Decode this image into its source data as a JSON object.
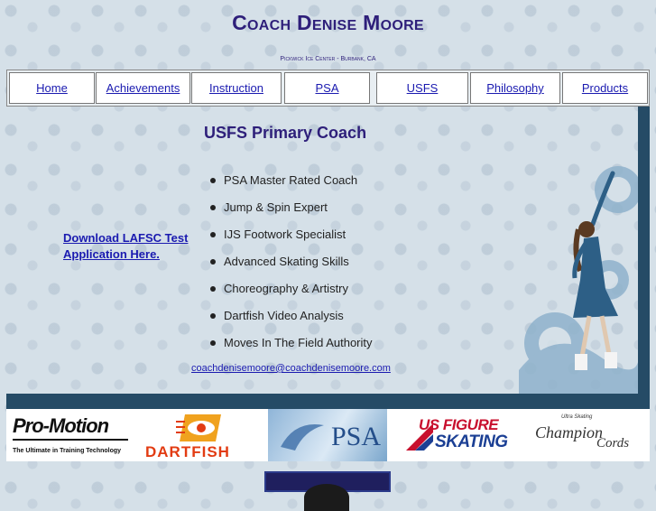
{
  "header": {
    "title": "Coach Denise Moore",
    "subtitle": "Pickwick Ice Center - Burbank, CA"
  },
  "nav": {
    "items": [
      {
        "label": "Home"
      },
      {
        "label": "Achievements"
      },
      {
        "label": "Instruction"
      },
      {
        "label": "PSA"
      },
      {
        "label": "USFS"
      },
      {
        "label": "Philosophy"
      },
      {
        "label": "Products"
      }
    ]
  },
  "main": {
    "heading": "USFS Primary Coach",
    "download_link": "Download LAFSC Test Application Here.",
    "features": [
      "PSA Master Rated Coach",
      "Jump & Spin Expert",
      "IJS Footwork Specialist",
      "Advanced Skating Skills",
      "Choreography & Artistry",
      "Dartfish Video Analysis",
      "Moves In The Field Authority"
    ],
    "email": "coachdenisemoore@coachdenisemoore.com"
  },
  "sponsors": {
    "promotion": {
      "name": "Pro-Motion",
      "tagline": "The Ultimate in Training Technology"
    },
    "dartfish": {
      "name": "DARTFISH"
    },
    "psa": {
      "name": "PSA"
    },
    "usfs": {
      "line1": "US FIGURE",
      "line2": "SKATING"
    },
    "champion": {
      "small": "Ultra Skating",
      "line1": "Champion",
      "line2": "Cords"
    }
  },
  "colors": {
    "title": "#2e1f7a",
    "link": "#1a1ab0",
    "bar": "#254b66"
  }
}
